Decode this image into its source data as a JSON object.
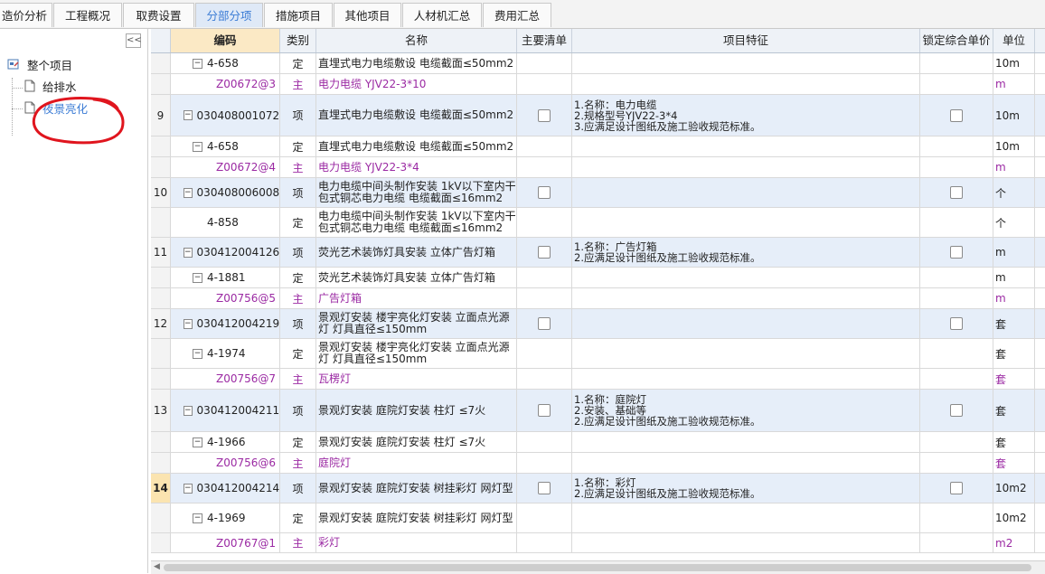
{
  "tabs": [
    {
      "label": "造价分析",
      "active": false
    },
    {
      "label": "工程概况",
      "active": false
    },
    {
      "label": "取费设置",
      "active": false
    },
    {
      "label": "分部分项",
      "active": true
    },
    {
      "label": "措施项目",
      "active": false
    },
    {
      "label": "其他项目",
      "active": false
    },
    {
      "label": "人材机汇总",
      "active": false
    },
    {
      "label": "费用汇总",
      "active": false
    }
  ],
  "tree": {
    "collapse_label": "<<",
    "root": "整个项目",
    "children": [
      "给排水",
      "夜景亮化"
    ],
    "selected": "夜景亮化"
  },
  "columns": {
    "code": "编码",
    "type": "类别",
    "name": "名称",
    "main_list": "主要清单",
    "feature": "项目特征",
    "lock_price": "锁定综合单价",
    "unit": "单位"
  },
  "rows": [
    {
      "num": "",
      "code": "4-658",
      "type": "定",
      "name": "直埋式电力电缆敷设 电缆截面≤50mm2",
      "feature": "",
      "unit": "10m",
      "level": "quota",
      "main": false
    },
    {
      "num": "",
      "code": "Z00672@3",
      "type": "主",
      "name": "电力电缆 YJV22-3*10",
      "feature": "",
      "unit": "m",
      "level": "material",
      "main": true
    },
    {
      "num": "9",
      "code": "030408001072",
      "type": "项",
      "name": "直埋式电力电缆敷设 电缆截面≤50mm2",
      "feature": "1.名称：电力电缆\n2.规格型号YJV22-3*4\n3.应满足设计图纸及施工验收规范标准。",
      "unit": "10m",
      "level": "bill",
      "main": false
    },
    {
      "num": "",
      "code": "4-658",
      "type": "定",
      "name": "直埋式电力电缆敷设 电缆截面≤50mm2",
      "feature": "",
      "unit": "10m",
      "level": "quota",
      "main": false
    },
    {
      "num": "",
      "code": "Z00672@4",
      "type": "主",
      "name": "电力电缆 YJV22-3*4",
      "feature": "",
      "unit": "m",
      "level": "material",
      "main": true
    },
    {
      "num": "10",
      "code": "030408006008",
      "type": "项",
      "name": "电力电缆中间头制作安装 1kV以下室内干包式铜芯电力电缆 电缆截面≤16mm2",
      "feature": "",
      "unit": "个",
      "level": "bill",
      "main": false
    },
    {
      "num": "",
      "code": "4-858",
      "type": "定",
      "name": "电力电缆中间头制作安装 1kV以下室内干包式铜芯电力电缆 电缆截面≤16mm2",
      "feature": "",
      "unit": "个",
      "level": "quota-leaf",
      "main": false
    },
    {
      "num": "11",
      "code": "030412004126",
      "type": "项",
      "name": "荧光艺术装饰灯具安装 立体广告灯箱",
      "feature": "1.名称：广告灯箱\n2.应满足设计图纸及施工验收规范标准。",
      "unit": "m",
      "level": "bill",
      "main": false
    },
    {
      "num": "",
      "code": "4-1881",
      "type": "定",
      "name": "荧光艺术装饰灯具安装 立体广告灯箱",
      "feature": "",
      "unit": "m",
      "level": "quota",
      "main": false
    },
    {
      "num": "",
      "code": "Z00756@5",
      "type": "主",
      "name": "广告灯箱",
      "feature": "",
      "unit": "m",
      "level": "material",
      "main": true
    },
    {
      "num": "12",
      "code": "030412004219",
      "type": "项",
      "name": "景观灯安装 楼宇亮化灯安装 立面点光源灯 灯具直径≤150mm",
      "feature": "",
      "unit": "套",
      "level": "bill",
      "main": false
    },
    {
      "num": "",
      "code": "4-1974",
      "type": "定",
      "name": "景观灯安装 楼宇亮化灯安装 立面点光源灯 灯具直径≤150mm",
      "feature": "",
      "unit": "套",
      "level": "quota",
      "main": false
    },
    {
      "num": "",
      "code": "Z00756@7",
      "type": "主",
      "name": "瓦楞灯",
      "feature": "",
      "unit": "套",
      "level": "material",
      "main": true
    },
    {
      "num": "13",
      "code": "030412004211",
      "type": "项",
      "name": "景观灯安装 庭院灯安装 柱灯 ≤7火",
      "feature": "1.名称：庭院灯\n2.安装、基础等\n2.应满足设计图纸及施工验收规范标准。",
      "unit": "套",
      "level": "bill",
      "main": false
    },
    {
      "num": "",
      "code": "4-1966",
      "type": "定",
      "name": "景观灯安装 庭院灯安装 柱灯 ≤7火",
      "feature": "",
      "unit": "套",
      "level": "quota",
      "main": false
    },
    {
      "num": "",
      "code": "Z00756@6",
      "type": "主",
      "name": "庭院灯",
      "feature": "",
      "unit": "套",
      "level": "material",
      "main": true
    },
    {
      "num": "14",
      "code": "030412004214",
      "type": "项",
      "name": "景观灯安装 庭院灯安装 树挂彩灯 网灯型",
      "feature": "1.名称：彩灯\n2.应满足设计图纸及施工验收规范标准。",
      "unit": "10m2",
      "level": "bill",
      "main": false,
      "current": true
    },
    {
      "num": "",
      "code": "4-1969",
      "type": "定",
      "name": "景观灯安装 庭院灯安装 树挂彩灯 网灯型",
      "feature": "",
      "unit": "10m2",
      "level": "quota",
      "main": false
    },
    {
      "num": "",
      "code": "Z00767@1",
      "type": "主",
      "name": "彩灯",
      "feature": "",
      "unit": "m2",
      "level": "material",
      "main": true
    }
  ],
  "colors": {
    "accent": "#3a7bd5",
    "material_text": "#9b2aa3",
    "bill_row": "#e6eef9",
    "code_header": "#fbe9c5",
    "annotation": "#e0151e"
  }
}
